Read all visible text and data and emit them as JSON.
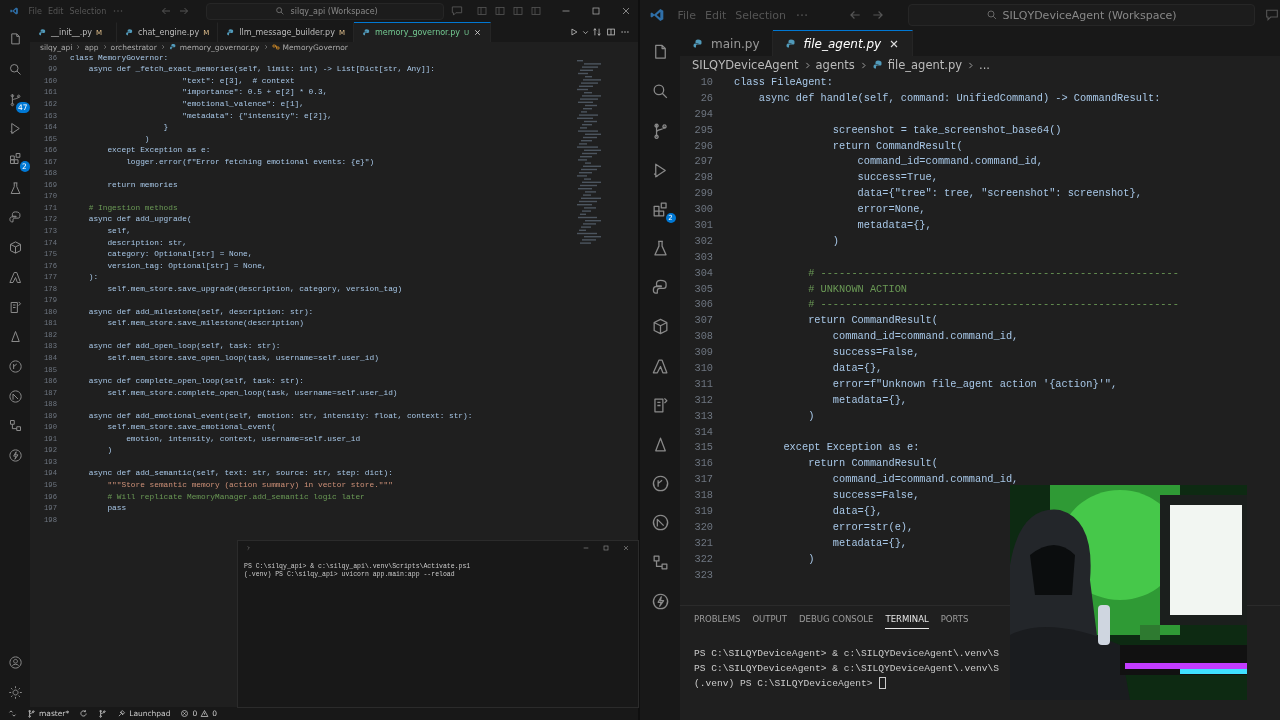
{
  "left": {
    "menu": [
      "File",
      "Edit",
      "Selection"
    ],
    "search": "silqy_api (Workspace)",
    "badges": {
      "source_control": "47",
      "extensions": "2"
    },
    "tabs": [
      {
        "label": "__init__.py",
        "status": "M",
        "kind": "modified",
        "selected": false
      },
      {
        "label": "chat_engine.py",
        "status": "M",
        "kind": "modified",
        "selected": false
      },
      {
        "label": "llm_message_builder.py",
        "status": "M",
        "kind": "modified",
        "selected": false
      },
      {
        "label": "memory_governor.py",
        "status": "U",
        "kind": "untracked",
        "selected": true
      }
    ],
    "breadcrumb": [
      {
        "label": "silqy_api",
        "kind": "folder"
      },
      {
        "label": "app",
        "kind": "folder"
      },
      {
        "label": "orchestrator",
        "kind": "folder"
      },
      {
        "label": "memory_governor.py",
        "kind": "file"
      },
      {
        "label": "MemoryGovernor",
        "kind": "class"
      }
    ],
    "code": [
      {
        "n": "36",
        "kind": "code",
        "text": "class MemoryGovernor:"
      },
      {
        "n": "99",
        "kind": "code",
        "text": "    async def _fetch_exact_memories(self, limit: int) -> List[Dict[str, Any]]:"
      },
      {
        "n": "160",
        "kind": "code",
        "text": "                        \"text\": e[3],  # context"
      },
      {
        "n": "161",
        "kind": "code",
        "text": "                        \"importance\": 0.5 + e[2] * 0.3,"
      },
      {
        "n": "162",
        "kind": "code",
        "text": "                        \"emotional_valence\": e[1],"
      },
      {
        "n": "163",
        "kind": "code",
        "text": "                        \"metadata\": {\"intensity\": e[2]},"
      },
      {
        "n": "164",
        "kind": "code",
        "text": "                    }"
      },
      {
        "n": "165",
        "kind": "code",
        "text": "                )"
      },
      {
        "n": "166",
        "kind": "code",
        "text": "        except Exception as e:"
      },
      {
        "n": "167",
        "kind": "code",
        "text": "            logger.error(f\"Error fetching emotional events: {e}\")"
      },
      {
        "n": "168",
        "kind": "blank"
      },
      {
        "n": "169",
        "kind": "code",
        "text": "        return memories"
      },
      {
        "n": "170",
        "kind": "blank"
      },
      {
        "n": "171",
        "kind": "comment",
        "text": "    # Ingestion methods"
      },
      {
        "n": "172",
        "kind": "code",
        "text": "    async def add_upgrade("
      },
      {
        "n": "173",
        "kind": "code",
        "text": "        self,"
      },
      {
        "n": "174",
        "kind": "code",
        "text": "        description: str,"
      },
      {
        "n": "175",
        "kind": "code",
        "text": "        category: Optional[str] = None,"
      },
      {
        "n": "176",
        "kind": "code",
        "text": "        version_tag: Optional[str] = None,"
      },
      {
        "n": "177",
        "kind": "code",
        "text": "    ):"
      },
      {
        "n": "178",
        "kind": "code",
        "text": "        self.mem_store.save_upgrade(description, category, version_tag)"
      },
      {
        "n": "179",
        "kind": "blank"
      },
      {
        "n": "180",
        "kind": "code",
        "text": "    async def add_milestone(self, description: str):"
      },
      {
        "n": "181",
        "kind": "code",
        "text": "        self.mem_store.save_milestone(description)"
      },
      {
        "n": "182",
        "kind": "blank"
      },
      {
        "n": "183",
        "kind": "code",
        "text": "    async def add_open_loop(self, task: str):"
      },
      {
        "n": "184",
        "kind": "code",
        "text": "        self.mem_store.save_open_loop(task, username=self.user_id)"
      },
      {
        "n": "185",
        "kind": "blank"
      },
      {
        "n": "186",
        "kind": "code",
        "text": "    async def complete_open_loop(self, task: str):"
      },
      {
        "n": "187",
        "kind": "code",
        "text": "        self.mem_store.complete_open_loop(task, username=self.user_id)"
      },
      {
        "n": "188",
        "kind": "blank"
      },
      {
        "n": "189",
        "kind": "code",
        "text": "    async def add_emotional_event(self, emotion: str, intensity: float, context: str):"
      },
      {
        "n": "190",
        "kind": "code",
        "text": "        self.mem_store.save_emotional_event("
      },
      {
        "n": "191",
        "kind": "code",
        "text": "            emotion, intensity, context, username=self.user_id"
      },
      {
        "n": "192",
        "kind": "code",
        "text": "        )"
      },
      {
        "n": "193",
        "kind": "blank"
      },
      {
        "n": "194",
        "kind": "code",
        "text": "    async def add_semantic(self, text: str, source: str, step: dict):"
      },
      {
        "n": "195",
        "kind": "string",
        "text": "        \"\"\"Store semantic memory (action summary) in vector store.\"\"\""
      },
      {
        "n": "196",
        "kind": "comment",
        "text": "        # Will replicate MemoryManager.add_semantic logic later"
      },
      {
        "n": "197",
        "kind": "code",
        "text": "        pass"
      },
      {
        "n": "198",
        "kind": "blank"
      }
    ],
    "terminal": [
      "PS C:\\silqy_api> & c:\\silqy_api\\.venv\\Scripts\\Activate.ps1",
      "(.venv) PS C:\\silqy_api> uvicorn app.main:app --reload"
    ],
    "status_bar": {
      "branch": "master*",
      "launchpad": "Launchpad",
      "errors": "0",
      "warnings": "0"
    }
  },
  "right": {
    "menu": [
      "File",
      "Edit",
      "Selection"
    ],
    "search": "SILQYDeviceAgent (Workspace)",
    "badges": {
      "extensions": "2"
    },
    "tabs": [
      {
        "label": "main.py",
        "selected": false,
        "preview": false
      },
      {
        "label": "file_agent.py",
        "selected": true,
        "preview": true
      }
    ],
    "breadcrumb": [
      {
        "label": "SILQYDeviceAgent",
        "kind": "folder"
      },
      {
        "label": "agents",
        "kind": "folder"
      },
      {
        "label": "file_agent.py",
        "kind": "file"
      },
      {
        "label": "...",
        "kind": "more"
      }
    ],
    "code": [
      {
        "n": "10",
        "kind": "code",
        "text": "class FileAgent:"
      },
      {
        "n": "26",
        "kind": "code",
        "text": "    async def handle(self, command: UnifiedCommand) -> CommandResult:"
      },
      {
        "n": "294",
        "kind": "blank"
      },
      {
        "n": "295",
        "kind": "code",
        "text": "                screenshot = take_screenshot_base64()"
      },
      {
        "n": "296",
        "kind": "code",
        "text": "                return CommandResult("
      },
      {
        "n": "297",
        "kind": "code",
        "text": "                    command_id=command.command_id,"
      },
      {
        "n": "298",
        "kind": "code",
        "text": "                    success=True,"
      },
      {
        "n": "299",
        "kind": "code",
        "text": "                    data={\"tree\": tree, \"screenshot\": screenshot},"
      },
      {
        "n": "300",
        "kind": "code",
        "text": "                    error=None,"
      },
      {
        "n": "301",
        "kind": "code",
        "text": "                    metadata={},"
      },
      {
        "n": "302",
        "kind": "code",
        "text": "                )"
      },
      {
        "n": "303",
        "kind": "blank"
      },
      {
        "n": "304",
        "kind": "comment",
        "text": "            # ----------------------------------------------------------"
      },
      {
        "n": "305",
        "kind": "comment",
        "text": "            # UNKNOWN ACTION"
      },
      {
        "n": "306",
        "kind": "comment",
        "text": "            # ----------------------------------------------------------"
      },
      {
        "n": "307",
        "kind": "code",
        "text": "            return CommandResult("
      },
      {
        "n": "308",
        "kind": "code",
        "text": "                command_id=command.command_id,"
      },
      {
        "n": "309",
        "kind": "code",
        "text": "                success=False,"
      },
      {
        "n": "310",
        "kind": "code",
        "text": "                data={},"
      },
      {
        "n": "311",
        "kind": "code",
        "text": "                error=f\"Unknown file_agent action '{action}'\","
      },
      {
        "n": "312",
        "kind": "code",
        "text": "                metadata={},"
      },
      {
        "n": "313",
        "kind": "code",
        "text": "            )"
      },
      {
        "n": "314",
        "kind": "blank"
      },
      {
        "n": "315",
        "kind": "code",
        "text": "        except Exception as e:"
      },
      {
        "n": "316",
        "kind": "code",
        "text": "            return CommandResult("
      },
      {
        "n": "317",
        "kind": "code",
        "text": "                command_id=command.command_id,"
      },
      {
        "n": "318",
        "kind": "code",
        "text": "                success=False,"
      },
      {
        "n": "319",
        "kind": "code",
        "text": "                data={},"
      },
      {
        "n": "320",
        "kind": "code",
        "text": "                error=str(e),"
      },
      {
        "n": "321",
        "kind": "code",
        "text": "                metadata={},"
      },
      {
        "n": "322",
        "kind": "code",
        "text": "            )"
      },
      {
        "n": "323",
        "kind": "blank"
      }
    ],
    "panel_tabs": [
      {
        "label": "PROBLEMS",
        "selected": false
      },
      {
        "label": "OUTPUT",
        "selected": false
      },
      {
        "label": "DEBUG CONSOLE",
        "selected": false
      },
      {
        "label": "TERMINAL",
        "selected": true
      },
      {
        "label": "PORTS",
        "selected": false
      }
    ],
    "terminal": [
      "PS C:\\SILQYDeviceAgent> & c:\\SILQYDeviceAgent\\.venv\\S",
      "PS C:\\SILQYDeviceAgent> & c:\\SILQYDeviceAgent\\.venv\\S",
      "(.venv) PS C:\\SILQYDeviceAgent>"
    ]
  }
}
